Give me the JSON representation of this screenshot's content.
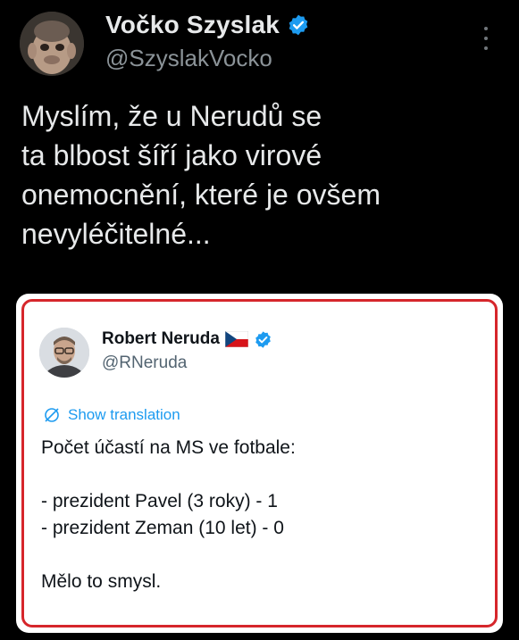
{
  "tweet": {
    "author_name": "Vočko Szyslak",
    "author_handle": "@SzyslakVocko",
    "text": "Myslím, že u Nerudů se\nta blbost šíří jako virové\nonemocnění, které je ovšem\nnevyléčitelné...",
    "verified_color": "#1d9bf0"
  },
  "quoted_tweet": {
    "author_name": "Robert Neruda",
    "author_handle": "@RNeruda",
    "show_translation_label": "Show translation",
    "lines": {
      "l1": "Počet účastí na MS ve fotbale:",
      "l2": "- prezident Pavel (3 roky) - 1",
      "l3": "- prezident Zeman (10 let) - 0",
      "l4": "Mělo to smysl."
    },
    "highlight_border_color": "#d6262b"
  },
  "icons": {
    "more": "more-options-icon",
    "verified": "verified-badge-icon",
    "flag": "czech-flag-icon",
    "translate": "translate-icon"
  }
}
